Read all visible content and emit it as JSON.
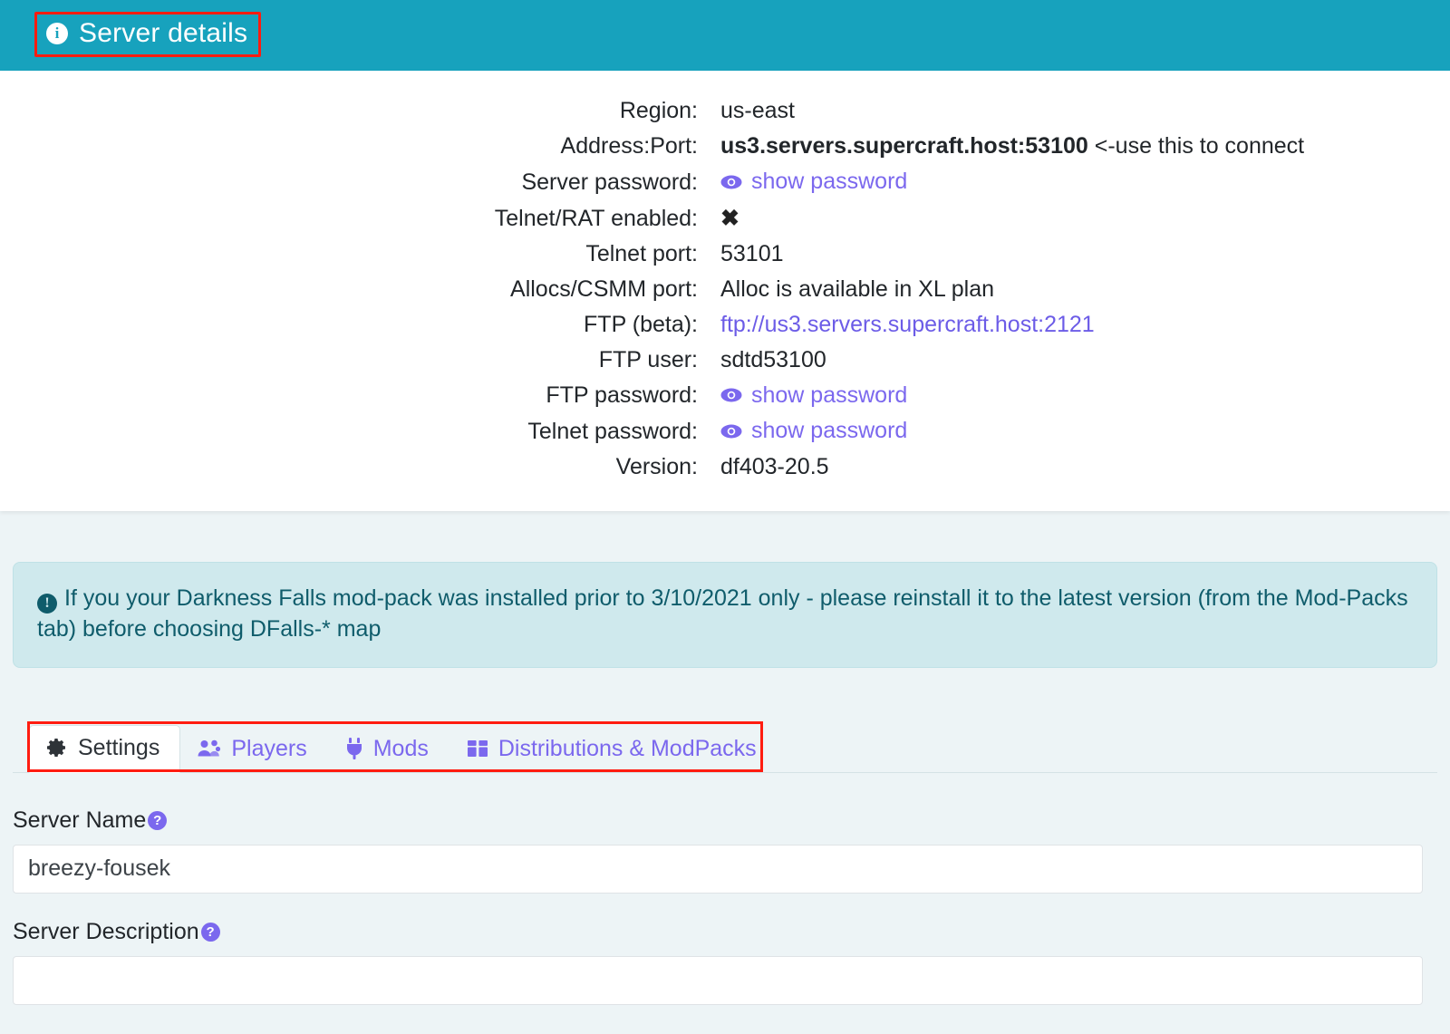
{
  "header": {
    "title": "Server details",
    "icon": "info-circle-icon",
    "background_color": "#17a2bd"
  },
  "details": [
    {
      "label": "Region:",
      "value": "us-east",
      "type": "text"
    },
    {
      "label": "Address:Port:",
      "value": "us3.servers.supercraft.host:53100",
      "suffix": "<-use this to connect",
      "type": "bold-text"
    },
    {
      "label": "Server password:",
      "value": "show password",
      "type": "password-link"
    },
    {
      "label": "Telnet/RAT enabled:",
      "value": "✖",
      "type": "cross"
    },
    {
      "label": "Telnet port:",
      "value": "53101",
      "type": "text"
    },
    {
      "label": "Allocs/CSMM port:",
      "value": "Alloc is available in XL plan",
      "type": "text"
    },
    {
      "label": "FTP (beta):",
      "value": "ftp://us3.servers.supercraft.host:2121",
      "type": "link"
    },
    {
      "label": "FTP user:",
      "value": "sdtd53100",
      "type": "text"
    },
    {
      "label": "FTP password:",
      "value": "show password",
      "type": "password-link"
    },
    {
      "label": "Telnet password:",
      "value": "show password",
      "type": "password-link"
    },
    {
      "label": "Version:",
      "value": "df403-20.5",
      "type": "text"
    }
  ],
  "notice": {
    "icon": "exclamation-circle-icon",
    "text": "If you your Darkness Falls mod-pack was installed prior to 3/10/2021 only - please reinstall it to the latest version (from the Mod-Packs tab) before choosing DFalls-* map",
    "background_color": "#cfe9ed",
    "text_color": "#0f5c6b"
  },
  "tabs": [
    {
      "label": "Settings",
      "icon": "gear-icon",
      "active": true
    },
    {
      "label": "Players",
      "icon": "users-icon",
      "active": false
    },
    {
      "label": "Mods",
      "icon": "plug-icon",
      "active": false
    },
    {
      "label": "Distributions & ModPacks",
      "icon": "box-icon",
      "active": false
    }
  ],
  "form": {
    "server_name": {
      "label": "Server Name",
      "help": "?",
      "value": "breezy-fousek",
      "placeholder": ""
    },
    "server_description": {
      "label": "Server Description",
      "help": "?",
      "value": "",
      "placeholder": ""
    }
  },
  "colors": {
    "accent_teal": "#17a2bd",
    "accent_purple": "#7b68ee",
    "page_background": "#edf4f6",
    "annotation_red": "#ff1c10"
  }
}
